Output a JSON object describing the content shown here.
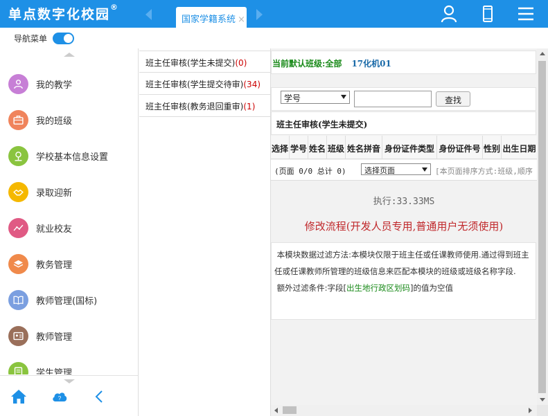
{
  "app": {
    "title": "单点数字化校园",
    "trademark": "®"
  },
  "tabs": [
    {
      "label": "国家学籍系统",
      "close": "×"
    }
  ],
  "colors": {
    "header": "#1e90e6",
    "accent_green": "#1a8a1a",
    "accent_red": "#c0282b",
    "count_red": "#cc0000"
  },
  "top_icons": [
    "user-icon",
    "mobile-icon",
    "menu-icon"
  ],
  "nav_toggle": {
    "label": "导航菜单",
    "on": true
  },
  "sidebar": {
    "items": [
      {
        "label": "我的教学",
        "icon": "person-icon",
        "color": "#c77fd6"
      },
      {
        "label": "我的班级",
        "icon": "briefcase-icon",
        "color": "#f0845c"
      },
      {
        "label": "学校基本信息设置",
        "icon": "location-pin-icon",
        "color": "#8ac43f"
      },
      {
        "label": "录取迎新",
        "icon": "handshake-icon",
        "color": "#f5b800"
      },
      {
        "label": "就业校友",
        "icon": "trend-line-icon",
        "color": "#e05a84"
      },
      {
        "label": "教务管理",
        "icon": "layers-icon",
        "color": "#f08a4b"
      },
      {
        "label": "教师管理(国标)",
        "icon": "book-icon",
        "color": "#7b9fe0"
      },
      {
        "label": "教师管理",
        "icon": "id-card-icon",
        "color": "#9a6f5a"
      },
      {
        "label": "学生管理",
        "icon": "document-icon",
        "color": "#8ac43f"
      }
    ],
    "bottom_icons": [
      "home-icon",
      "cloud-help-icon",
      "collapse-left-icon"
    ]
  },
  "midlist": {
    "items": [
      {
        "label": "班主任审核(学生未提交)",
        "count": "(0)"
      },
      {
        "label": "班主任审核(学生提交待审)",
        "count": "(34)"
      },
      {
        "label": "班主任审核(教务退回重审)",
        "count": "(1)"
      }
    ]
  },
  "content": {
    "current_class_key": "当前默认班级:",
    "current_class_value": "全部",
    "current_class_name": "17化机01",
    "search": {
      "field_selected": "学号",
      "input_value": "",
      "button": "查找"
    },
    "table_title": "班主任审核(学生未提交)",
    "columns": [
      {
        "label": "选择"
      },
      {
        "label": "学号"
      },
      {
        "label": "姓名"
      },
      {
        "label": "班级"
      },
      {
        "label": "姓名拼音"
      },
      {
        "label": "身份证件类型"
      },
      {
        "label": "身份证件号"
      },
      {
        "label": "性别"
      },
      {
        "label": "出生日期"
      }
    ],
    "pager": {
      "info": "(页面 0/0  总计 0)",
      "page_select": "选择页面",
      "sort_text": "[本页面排序方式:班级,顺序"
    },
    "exec": "执行:33.33MS",
    "flow": "修改流程(开发人员专用,普通用户无须使用)",
    "desc_line1": "本模块数据过滤方法:本模块仅限于班主任或任课教师使用.通过得到班主任或任课教师所管理的班级信息来匹配本模块的班级或班级名称字段.",
    "desc_line2_prefix": "额外过滤条件:字段[",
    "desc_line2_field": "出生地行政区划码",
    "desc_line2_suffix": "]的值为空值"
  }
}
